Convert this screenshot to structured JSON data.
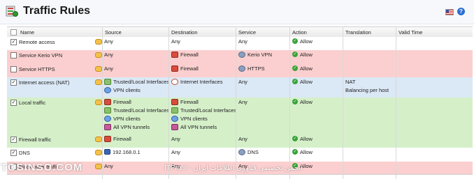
{
  "app": {
    "title": "Traffic Rules"
  },
  "columns": [
    "Name",
    "Source",
    "Destination",
    "Service",
    "Action",
    "Translation",
    "Valid Time"
  ],
  "rows": [
    {
      "checked": true,
      "color": "white",
      "name": "Remote access",
      "source": [
        {
          "icon": "none",
          "text": "Any"
        }
      ],
      "destination": [
        {
          "icon": "none",
          "text": "Any"
        }
      ],
      "service": [
        {
          "icon": "none",
          "text": "Any"
        }
      ],
      "action": "Allow",
      "translation": []
    },
    {
      "checked": false,
      "color": "red",
      "name": "Service Kerio VPN",
      "source": [
        {
          "icon": "none",
          "text": "Any"
        }
      ],
      "destination": [
        {
          "icon": "firewall-icon",
          "text": "Firewall"
        }
      ],
      "service": [
        {
          "icon": "service-icon",
          "text": "Kerio VPN"
        }
      ],
      "action": "Allow",
      "translation": []
    },
    {
      "checked": false,
      "color": "red",
      "name": "Service HTTPS",
      "source": [
        {
          "icon": "none",
          "text": "Any"
        }
      ],
      "destination": [
        {
          "icon": "firewall-icon",
          "text": "Firewall"
        }
      ],
      "service": [
        {
          "icon": "service-icon",
          "text": "HTTPS"
        }
      ],
      "action": "Allow",
      "translation": []
    },
    {
      "checked": true,
      "color": "blue",
      "name": "Internet access (NAT)",
      "source": [
        {
          "icon": "interfaces-icon",
          "text": "Trusted/Local Interfaces"
        },
        {
          "icon": "vpn-clients-icon",
          "text": "VPN clients"
        }
      ],
      "destination": [
        {
          "icon": "internet-icon",
          "text": "Internet Interfaces"
        }
      ],
      "service": [
        {
          "icon": "none",
          "text": "Any"
        }
      ],
      "action": "Allow",
      "translation": [
        "NAT",
        "Balancing per host"
      ]
    },
    {
      "checked": true,
      "color": "green",
      "name": "Local traffic",
      "source": [
        {
          "icon": "firewall-icon",
          "text": "Firewall"
        },
        {
          "icon": "interfaces-icon",
          "text": "Trusted/Local Interfaces"
        },
        {
          "icon": "vpn-clients-icon",
          "text": "VPN clients"
        },
        {
          "icon": "vpn-tunnels-icon",
          "text": "All VPN tunnels"
        }
      ],
      "destination": [
        {
          "icon": "firewall-icon",
          "text": "Firewall"
        },
        {
          "icon": "interfaces-icon",
          "text": "Trusted/Local Interfaces"
        },
        {
          "icon": "vpn-clients-icon",
          "text": "VPN clients"
        },
        {
          "icon": "vpn-tunnels-icon",
          "text": "All VPN tunnels"
        }
      ],
      "service": [
        {
          "icon": "none",
          "text": "Any"
        }
      ],
      "action": "Allow",
      "translation": []
    },
    {
      "checked": true,
      "color": "green",
      "name": "Firewall traffic",
      "source": [
        {
          "icon": "firewall-icon",
          "text": "Firewall"
        }
      ],
      "destination": [
        {
          "icon": "none",
          "text": "Any"
        }
      ],
      "service": [
        {
          "icon": "none",
          "text": "Any"
        }
      ],
      "action": "Allow",
      "translation": []
    },
    {
      "checked": true,
      "color": "white",
      "name": "DNS",
      "source": [
        {
          "icon": "host-icon",
          "text": "192.168.0.1"
        }
      ],
      "destination": [
        {
          "icon": "none",
          "text": "Any"
        }
      ],
      "service": [
        {
          "icon": "service-icon",
          "text": "DNS"
        }
      ],
      "action": "Allow",
      "translation": []
    },
    {
      "checked": false,
      "color": "red",
      "name": "Block other traffic",
      "source": [
        {
          "icon": "none",
          "text": "Any"
        }
      ],
      "destination": [
        {
          "icon": "none",
          "text": "Any"
        }
      ],
      "service": [
        {
          "icon": "none",
          "text": "Any"
        }
      ],
      "action": "Allow",
      "translation": []
    }
  ],
  "watermark": {
    "left": "TOSINSO.COM",
    "right": "ITPro.ir - انجمن تخصصی فناوری اطلاعات ایران"
  },
  "colors": {
    "red_row": "#fbcfcf",
    "blue_row": "#dbe8f6",
    "green_row": "#d5f0c9",
    "allow": "#3aa33a"
  }
}
